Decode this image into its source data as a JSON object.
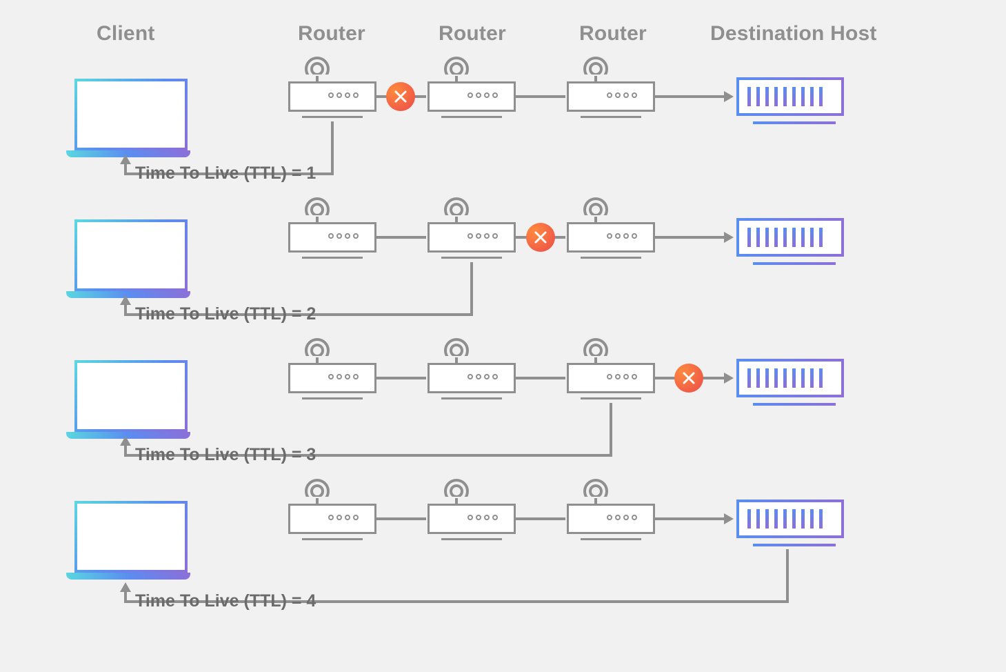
{
  "headers": {
    "client": "Client",
    "router": "Router",
    "destination": "Destination Host"
  },
  "rows": [
    {
      "ttl_label": "Time To Live (TTL) = 1",
      "stop_after_router": 1
    },
    {
      "ttl_label": "Time To Live (TTL) = 2",
      "stop_after_router": 2
    },
    {
      "ttl_label": "Time To Live (TTL) = 3",
      "stop_after_router": 3
    },
    {
      "ttl_label": "Time To Live (TTL) = 4",
      "stop_after_router": 4
    }
  ],
  "icons": {
    "laptop": "laptop-icon",
    "router": "router-icon",
    "server": "server-icon",
    "stop": "stop-x-icon"
  }
}
